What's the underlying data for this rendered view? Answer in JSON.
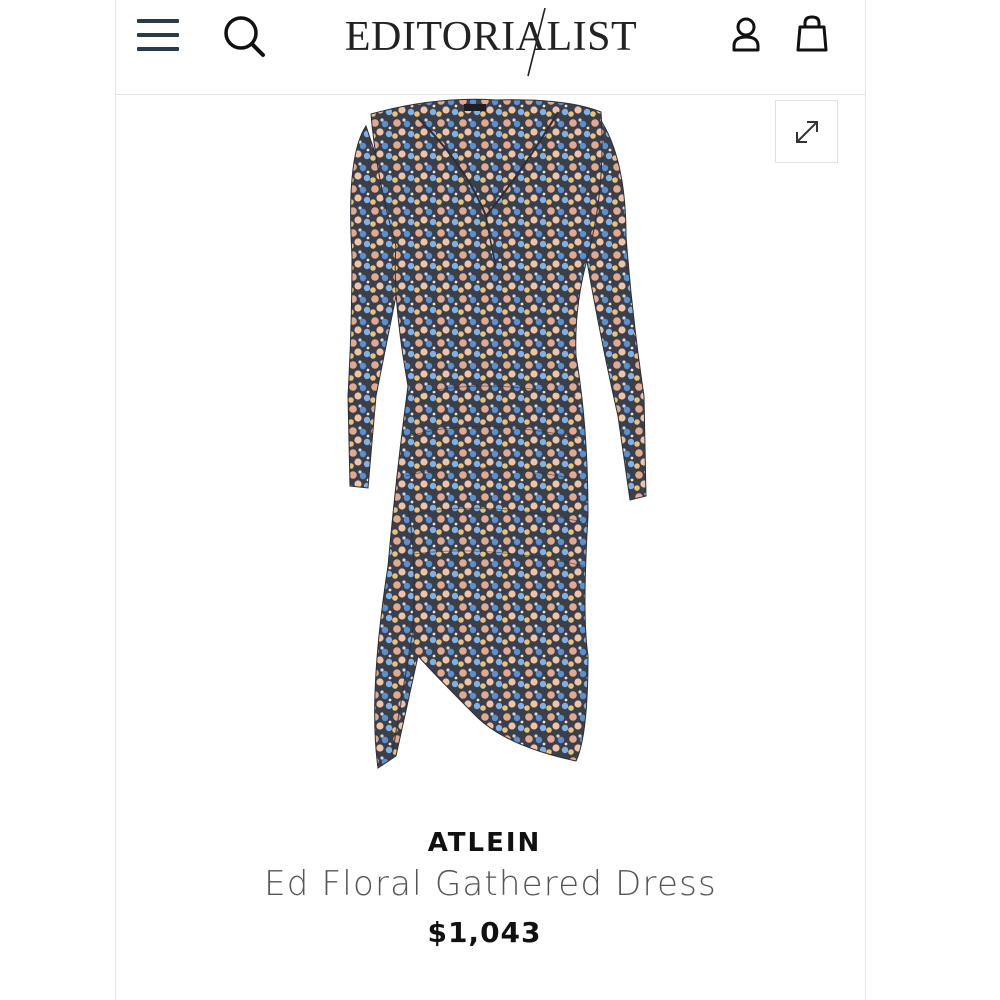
{
  "header": {
    "logo": "EDITORIALIST",
    "icons": {
      "menu": "hamburger-menu-icon",
      "search": "search-icon",
      "account": "user-account-icon",
      "bag": "shopping-bag-icon"
    }
  },
  "gallery": {
    "expand_icon": "expand-arrows-icon",
    "image": "floral-wrap-dress"
  },
  "product": {
    "brand": "ATLEIN",
    "name": "Ed Floral Gathered Dress",
    "price": "$1,043"
  },
  "colors": {
    "text": "#111111",
    "muted": "#555555",
    "border": "#e4e4e4",
    "icon": "#2b3a4a"
  }
}
